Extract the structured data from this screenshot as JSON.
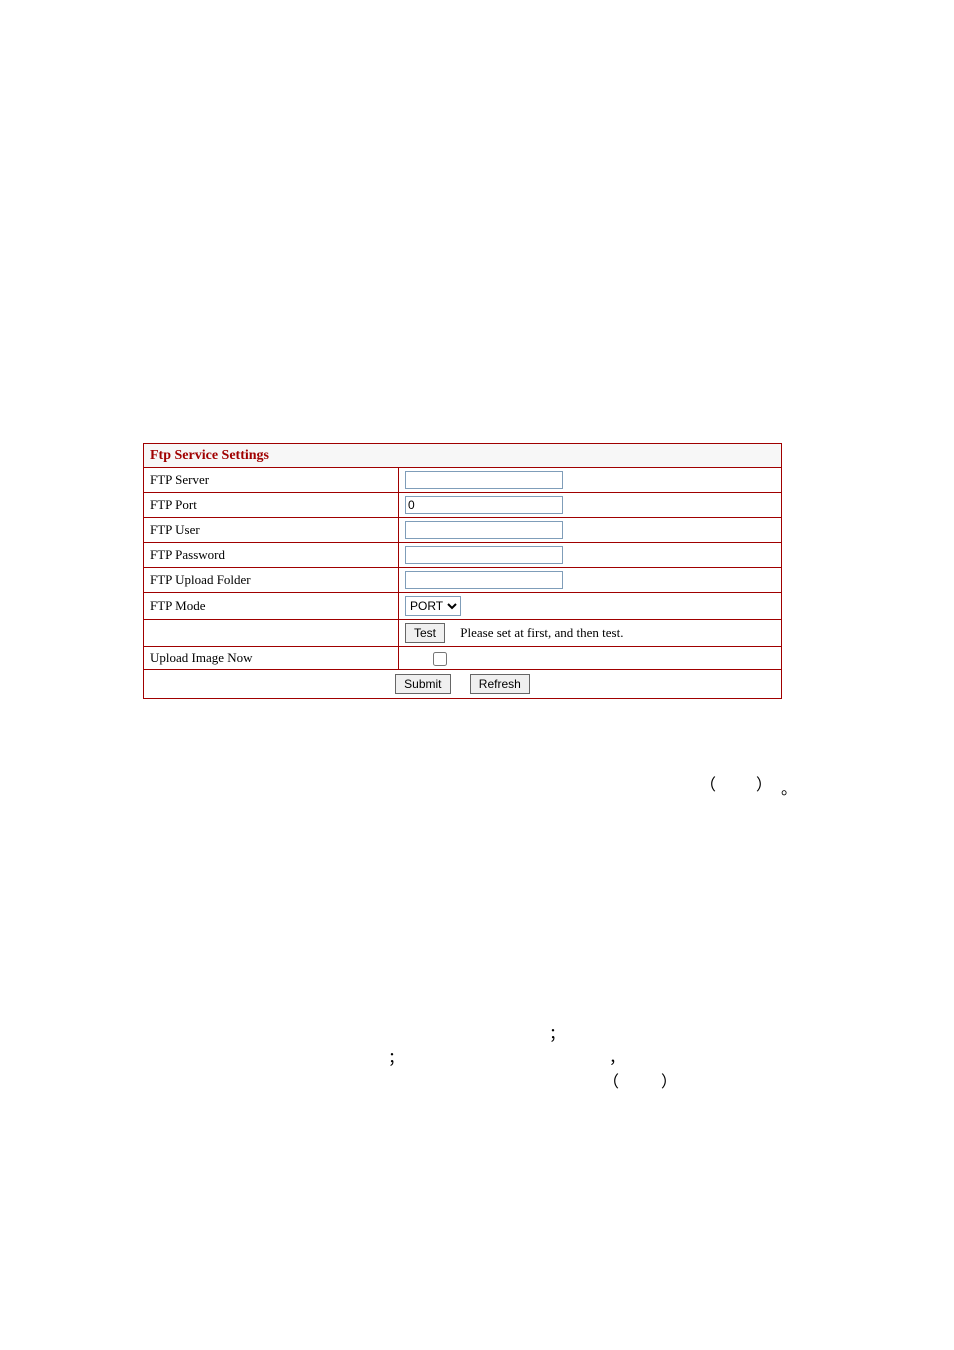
{
  "form": {
    "title": "Ftp Service Settings",
    "fields": {
      "server": {
        "label": "FTP Server",
        "value": ""
      },
      "port": {
        "label": "FTP Port",
        "value": "0"
      },
      "user": {
        "label": "FTP User",
        "value": ""
      },
      "password": {
        "label": "FTP Password",
        "value": ""
      },
      "upload_folder": {
        "label": "FTP Upload Folder",
        "value": ""
      },
      "mode": {
        "label": "FTP Mode",
        "selected": "PORT",
        "options": [
          "PORT"
        ]
      },
      "test": {
        "button": "Test",
        "hint": "Please set at first, and then test."
      },
      "upload_now": {
        "label": "Upload Image Now",
        "checked": false
      }
    },
    "buttons": {
      "submit": "Submit",
      "refresh": "Refresh"
    }
  },
  "decorative": {
    "paren_open": "（",
    "paren_close": "）",
    "full_stop": "。",
    "semicolon": "；",
    "comma": "，"
  }
}
